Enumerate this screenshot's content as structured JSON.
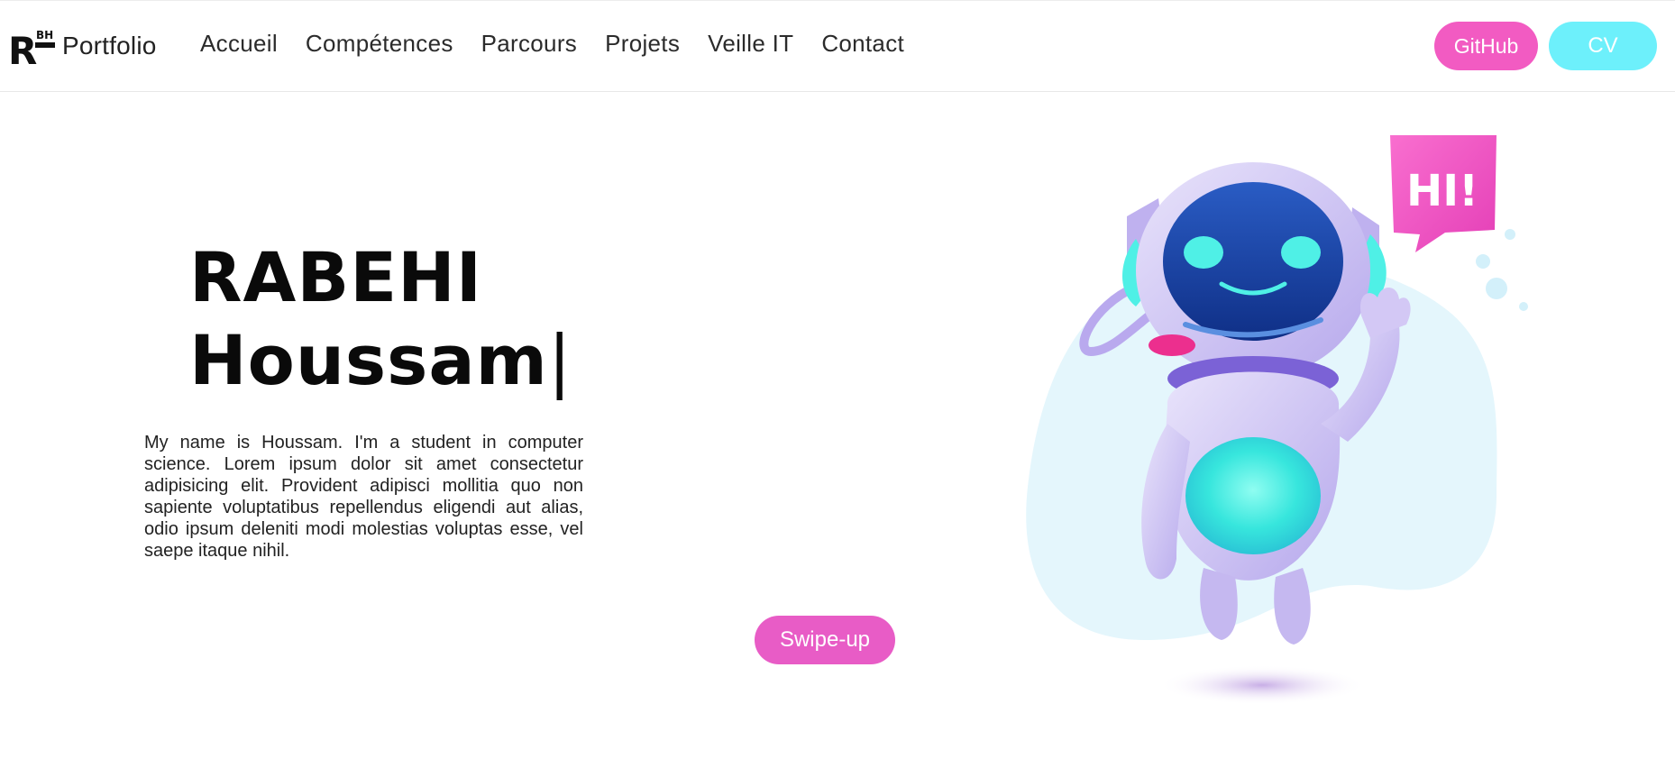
{
  "brand": {
    "logo_text": "R",
    "logo_small": "BH",
    "label": "Portfolio"
  },
  "nav": {
    "items": [
      {
        "label": "Accueil"
      },
      {
        "label": "Compétences"
      },
      {
        "label": "Parcours"
      },
      {
        "label": "Projets"
      },
      {
        "label": "Veille IT"
      },
      {
        "label": "Contact"
      }
    ],
    "github_label": "GitHub",
    "cv_label": "CV"
  },
  "hero": {
    "name_line1": "RABEHI",
    "name_line2": "Houssam",
    "caret": "|",
    "description": "My name is Houssam. I'm a student in computer science. Lorem ipsum dolor sit amet consectetur adipisicing elit. Provident adipisci mollitia quo non sapiente voluptatibus repellendus eligendi aut alias, odio ipsum deleniti modi molestias voluptas esse, vel saepe itaque nihil.",
    "swipe_label": "Swipe-up"
  },
  "illustration": {
    "bubble_text": "HI!"
  },
  "colors": {
    "pink": "#f25bc2",
    "cyan": "#6df0fb",
    "swipe": "#e85cc6",
    "robot_body": "#cfc4f3",
    "robot_visor": "#1b4aa8",
    "robot_accent": "#4ff0e6",
    "blob": "#e4f6fc"
  }
}
